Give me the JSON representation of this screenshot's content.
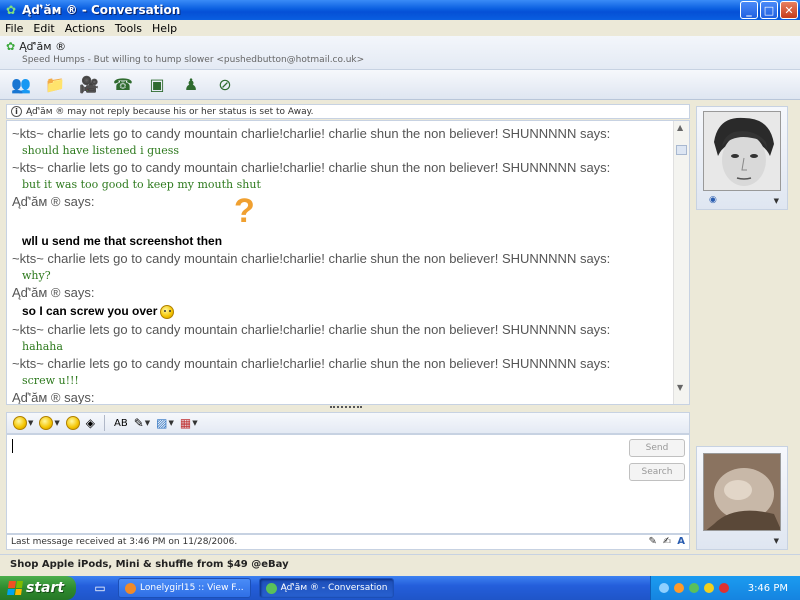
{
  "window": {
    "title": "Ąď'ăм ® - Conversation"
  },
  "menu": [
    "File",
    "Edit",
    "Actions",
    "Tools",
    "Help"
  ],
  "contact": {
    "name": "Ąď'ăм ®",
    "status": "Speed Humps - But willing to hump slower <pushedbutton@hotmail.co.uk>"
  },
  "toolbar": {
    "icons": [
      "invite-contact-icon",
      "send-files-icon",
      "video-call-icon",
      "voice-call-icon",
      "activities-icon",
      "games-icon",
      "block-icon"
    ]
  },
  "notice": "Ąď'ăм ® may not reply because his or her status is set to Away.",
  "messages": [
    {
      "header": "~kts~ charlie lets go to candy mountain charlie!charlie! charlie shun the non believer! SHUNNNNN says:",
      "body": "should have listened i guess"
    },
    {
      "header": "~kts~ charlie lets go to candy mountain charlie!charlie! charlie shun the non believer! SHUNNNNN says:",
      "body": "but it was too good to keep my mouth shut"
    },
    {
      "header": "Ąď'ăм ® says:",
      "body": "wll u send me that screenshot then"
    },
    {
      "header": "~kts~ charlie lets go to candy mountain charlie!charlie! charlie shun the non believer! SHUNNNNN says:",
      "body": "why?"
    },
    {
      "header": "Ąď'ăм ® says:",
      "body": "so I can screw you over"
    },
    {
      "header": "~kts~ charlie lets go to candy mountain charlie!charlie! charlie shun the non believer! SHUNNNNN says:",
      "body": "hahaha"
    },
    {
      "header": "~kts~ charlie lets go to candy mountain charlie!charlie! charlie shun the non believer! SHUNNNNN says:",
      "body": "screw u!!!"
    },
    {
      "header": "Ąď'ăм ® says:",
      "body": ""
    }
  ],
  "qmark": "?",
  "compose": {
    "send_label": "Send",
    "search_label": "Search"
  },
  "status_line": "Last message received at 3:46 PM on 11/28/2006.",
  "ad": "Shop Apple iPods, Mini & shuffle from $49 @eBay",
  "taskbar": {
    "start_label": "start",
    "tasks": [
      "Lonelygirl15 :: View F...",
      "Ąď'ăм ® - Conversation"
    ],
    "clock": "3:46 PM"
  }
}
